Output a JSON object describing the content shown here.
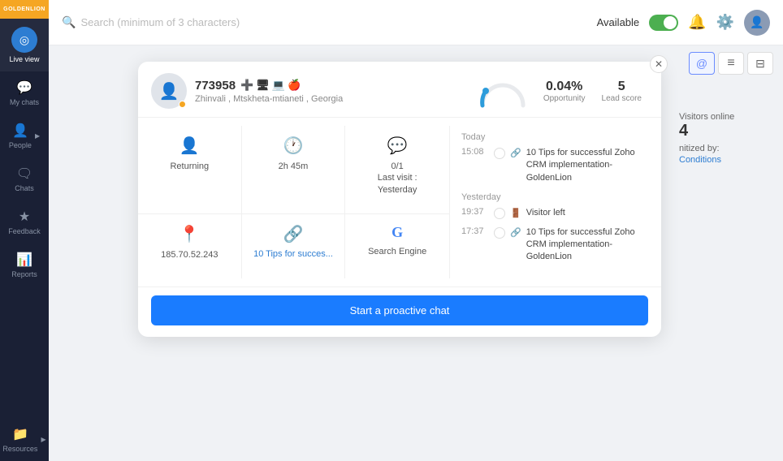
{
  "app": {
    "brand": "GOLDENLION",
    "search_placeholder": "Search (minimum of 3 characters)",
    "available_label": "Available",
    "page_title": "Live view"
  },
  "sidebar": {
    "items": [
      {
        "id": "live-view",
        "label": "Live view",
        "icon": "◎",
        "active": true
      },
      {
        "id": "my-chats",
        "label": "My chats",
        "icon": "💬",
        "active": false
      },
      {
        "id": "people",
        "label": "People",
        "icon": "👤",
        "active": false,
        "has_arrow": true
      },
      {
        "id": "chats",
        "label": "Chats",
        "icon": "🗨",
        "active": false
      },
      {
        "id": "feedback",
        "label": "Feedback",
        "icon": "★",
        "active": false
      },
      {
        "id": "reports",
        "label": "Reports",
        "icon": "📊",
        "active": false
      },
      {
        "id": "resources",
        "label": "Resources",
        "icon": "📁",
        "active": false,
        "has_arrow": true
      }
    ]
  },
  "visitors": {
    "online_label": "Visitors online",
    "count": "4",
    "filter_label": "nitized by:",
    "conditions_label": "Conditions"
  },
  "visitor_card": {
    "id": "773958",
    "location": "Zhinvali , Mtskheta-mtianeti , Georgia",
    "opportunity_value": "0.04%",
    "opportunity_label": "Opportunity",
    "lead_score_value": "5",
    "lead_score_label": "Lead score",
    "stats": [
      {
        "icon": "👤",
        "label": "Returning"
      },
      {
        "icon": "🕐",
        "label": "2h 45m"
      },
      {
        "icon": "💬",
        "label": "0/1\nLast visit :\nYesterday"
      },
      {
        "icon": "📍",
        "label": "185.70.52.243"
      },
      {
        "icon": "🔗",
        "label": "10 Tips for succes...",
        "is_link": true
      },
      {
        "icon": "G",
        "label": "Search Engine"
      }
    ],
    "cta_label": "Start a proactive chat",
    "timeline": {
      "sections": [
        {
          "date": "Today",
          "items": [
            {
              "time": "15:08",
              "icon": "🔗",
              "text": "10 Tips for successful Zoho CRM implementation-GoldenLion"
            }
          ]
        },
        {
          "date": "Yesterday",
          "items": [
            {
              "time": "19:37",
              "icon": "🚪",
              "text": "Visitor left"
            },
            {
              "time": "17:37",
              "icon": "🔗",
              "text": "10 Tips for successful Zoho CRM implementation-GoldenLion"
            }
          ]
        }
      ]
    }
  },
  "subtabs": [
    {
      "id": "at-sign",
      "icon": "@",
      "active": true
    },
    {
      "id": "list",
      "icon": "≡",
      "active": false
    },
    {
      "id": "filter",
      "icon": "⊟",
      "active": false
    }
  ]
}
